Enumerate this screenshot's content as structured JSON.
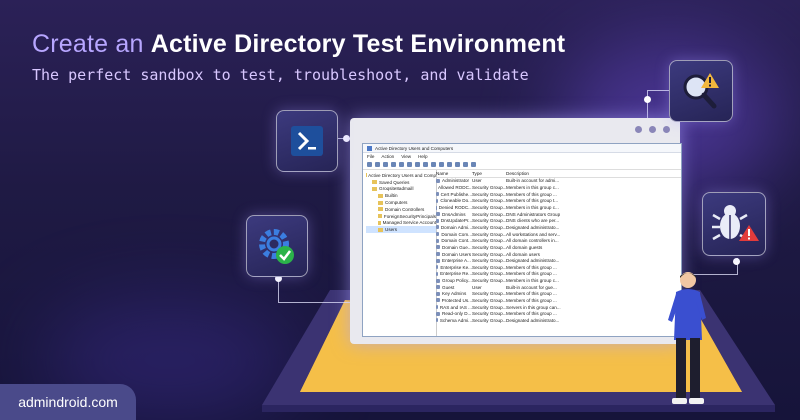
{
  "header": {
    "title_part1": "Create an",
    "title_part2": "Active Directory Test Environment",
    "subtitle": "The perfect sandbox to test, troubleshoot, and validate"
  },
  "icons": [
    "powershell-icon",
    "settings-check-icon",
    "search-warning-icon",
    "bug-warning-icon"
  ],
  "window": {
    "title": "Active Directory Users and Computers",
    "menu": [
      "File",
      "Action",
      "View",
      "Help"
    ],
    "tree": [
      {
        "label": "Active Directory Users and Comp",
        "level": 0
      },
      {
        "label": "Saved Queries",
        "level": 1
      },
      {
        "label": "Groqsite8admaill",
        "level": 1
      },
      {
        "label": "Builtin",
        "level": 2
      },
      {
        "label": "Computers",
        "level": 2
      },
      {
        "label": "Domain Controllers",
        "level": 2
      },
      {
        "label": "ForeignSecurityPrincipals",
        "level": 2
      },
      {
        "label": "Managed Service Account",
        "level": 2
      },
      {
        "label": "Users",
        "level": 2,
        "selected": true
      }
    ],
    "columns": [
      "Name",
      "Type",
      "Description"
    ],
    "rows": [
      [
        "Administrator",
        "User",
        "Built-in account for admi..."
      ],
      [
        "Allowed RODC...",
        "Security Group...",
        "Members in this group c..."
      ],
      [
        "Cert Publishe...",
        "Security Group...",
        "Members of this group ..."
      ],
      [
        "Cloneable Do...",
        "Security Group...",
        "Members of this group t..."
      ],
      [
        "Denied RODC...",
        "Security Group...",
        "Members in this group c..."
      ],
      [
        "DnsAdmins",
        "Security Group...",
        "DNS Administrators Group"
      ],
      [
        "DnsUpdatePr...",
        "Security Group...",
        "DNS clients who are per..."
      ],
      [
        "Domain Admi...",
        "Security Group...",
        "Designated administrato..."
      ],
      [
        "Domain Com...",
        "Security Group...",
        "All workstations and serv..."
      ],
      [
        "Domain Cont...",
        "Security Group...",
        "All domain controllers in..."
      ],
      [
        "Domain Gue...",
        "Security Group...",
        "All domain guests"
      ],
      [
        "Domain Users",
        "Security Group...",
        "All domain users"
      ],
      [
        "Enterprise A...",
        "Security Group...",
        "Designated administrato..."
      ],
      [
        "Enterprise Ke...",
        "Security Group...",
        "Members of this group ..."
      ],
      [
        "Enterprise Re...",
        "Security Group...",
        "Members of this group ..."
      ],
      [
        "Group Policy...",
        "Security Group...",
        "Members in this group c..."
      ],
      [
        "Guest",
        "User",
        "Built-in account for gue..."
      ],
      [
        "Key Admins",
        "Security Group...",
        "Members of this group ..."
      ],
      [
        "Protected Us...",
        "Security Group...",
        "Members of this group ..."
      ],
      [
        "RAS and IAS ...",
        "Security Group...",
        "Servers in this group can..."
      ],
      [
        "Read-only D...",
        "Security Group...",
        "Members of this group ..."
      ],
      [
        "Schema Admi...",
        "Security Group...",
        "Designated administrato..."
      ]
    ]
  },
  "footer": {
    "brand": "admindroid.com"
  },
  "colors": {
    "bg": "#1f1a44",
    "accent": "#b7a6ff",
    "sand": "#f2b73c",
    "card": "#2f2d66"
  }
}
